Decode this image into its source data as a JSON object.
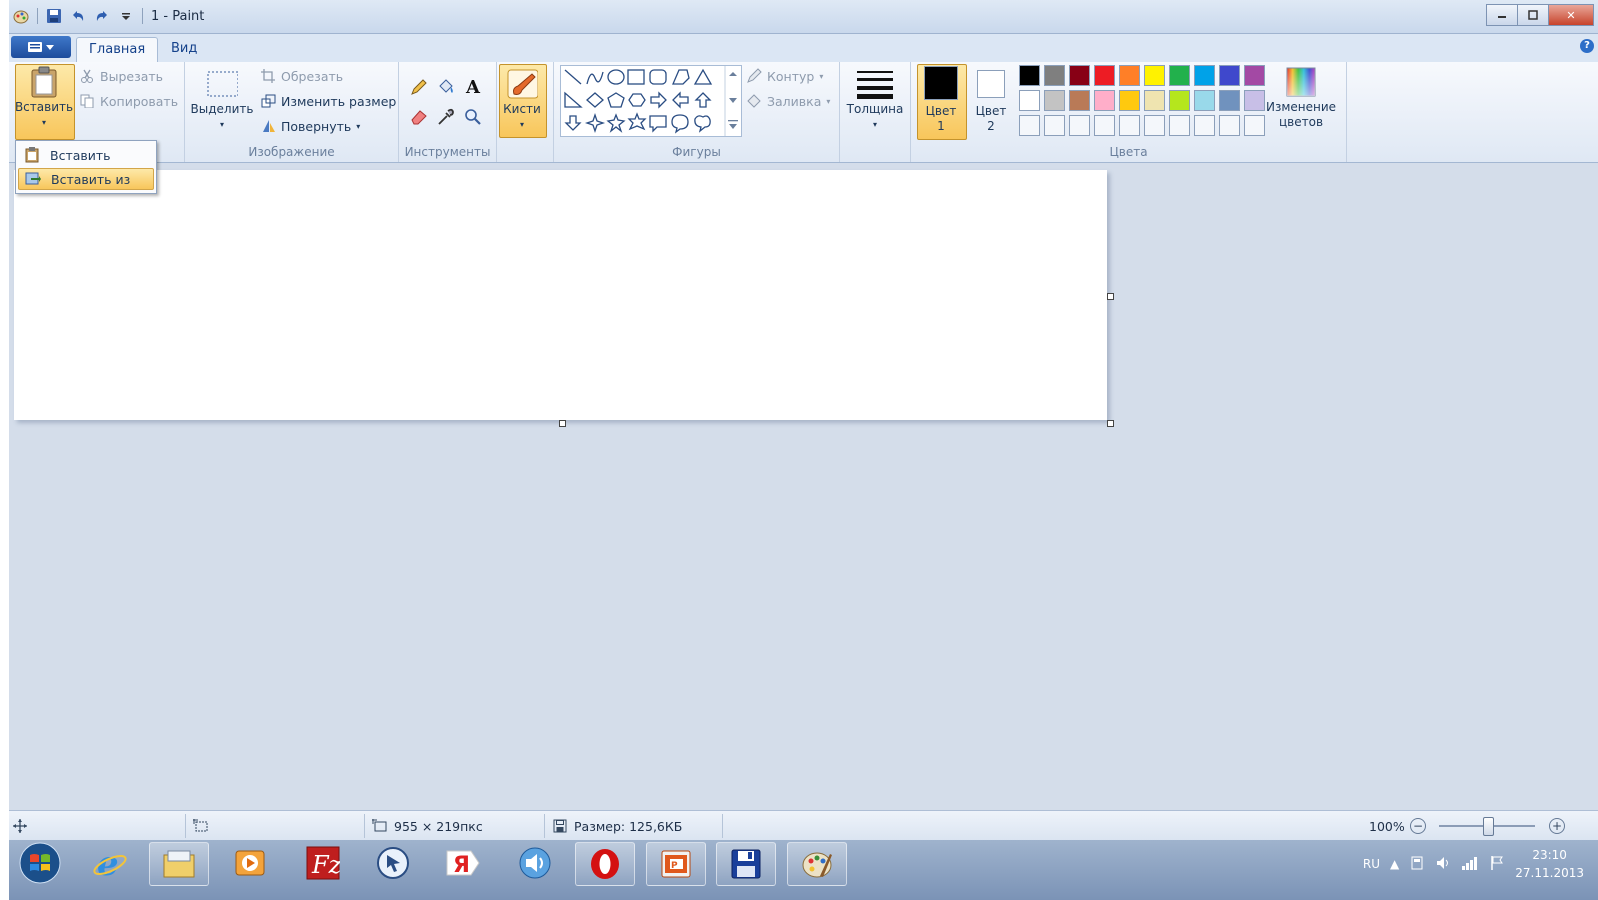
{
  "window": {
    "title": "1 - Paint"
  },
  "tabs": [
    {
      "label": "Главная"
    },
    {
      "label": "Вид"
    }
  ],
  "clipboard": {
    "paste": "Вставить",
    "cut": "Вырезать",
    "copy": "Копировать"
  },
  "image_group": {
    "label": "Изображение",
    "select": "Выделить",
    "crop": "Обрезать",
    "resize": "Изменить размер",
    "rotate": "Повернуть"
  },
  "tools_group": {
    "label": "Инструменты"
  },
  "brushes": {
    "label": "Кисти"
  },
  "shapes_group": {
    "label": "Фигуры",
    "outline": "Контур",
    "fill": "Заливка"
  },
  "thickness": {
    "label": "Толщина"
  },
  "colors_group": {
    "label": "Цвета",
    "color1": "Цвет 1",
    "color2": "Цвет 2",
    "edit_colors": "Изменение цветов",
    "palette_row1": [
      "#000000",
      "#7f7f7f",
      "#880015",
      "#ed1c24",
      "#ff7f27",
      "#fff200",
      "#22b14c",
      "#00a2e8",
      "#3f48cc",
      "#a349a4"
    ],
    "palette_row2": [
      "#ffffff",
      "#c3c3c3",
      "#b97a57",
      "#ffaec9",
      "#ffc90e",
      "#efe4b0",
      "#b5e61d",
      "#99d9ea",
      "#7092be",
      "#c8bfe7"
    ],
    "color1_value": "#000000",
    "color2_value": "#ffffff"
  },
  "paste_menu": {
    "items": [
      {
        "label": "Вставить"
      },
      {
        "label": "Вставить из"
      }
    ]
  },
  "status": {
    "canvas_size": "955 × 219пкс",
    "file_size": "Размер: 125,6КБ",
    "zoom": "100%"
  },
  "taskbar": {
    "lang": "RU",
    "time": "23:10",
    "date": "27.11.2013"
  }
}
